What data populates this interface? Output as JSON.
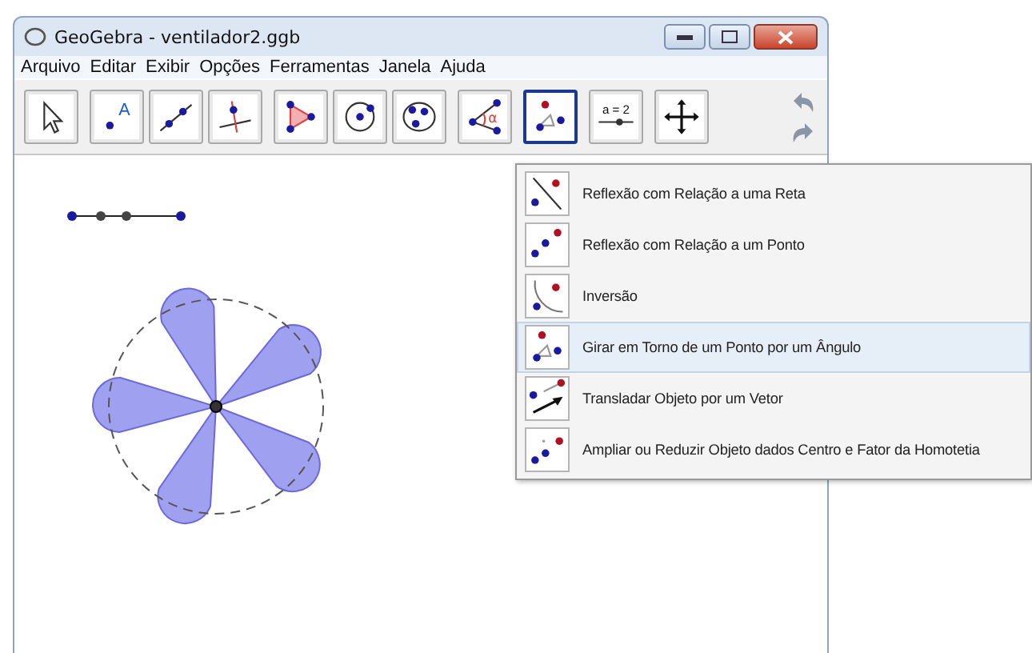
{
  "window": {
    "title": "GeoGebra - ventilador2.ggb"
  },
  "menu": [
    "Arquivo",
    "Editar",
    "Exibir",
    "Opções",
    "Ferramentas",
    "Janela",
    "Ajuda"
  ],
  "toolbar": [
    {
      "kind": "move",
      "selected": false
    },
    {
      "kind": "point",
      "label": "A",
      "selected": false
    },
    {
      "kind": "line",
      "selected": false
    },
    {
      "kind": "perpendicular",
      "selected": false
    },
    {
      "kind": "polygon",
      "selected": false
    },
    {
      "kind": "circle",
      "selected": false
    },
    {
      "kind": "conic",
      "selected": false
    },
    {
      "kind": "angle",
      "label": "α",
      "selected": false
    },
    {
      "kind": "rotate",
      "selected": true
    },
    {
      "kind": "slider",
      "label": "a = 2",
      "selected": false
    },
    {
      "kind": "pan",
      "selected": false
    }
  ],
  "tool_menu": [
    {
      "kind": "reflect-line",
      "label": "Reflexão com Relação a uma Reta",
      "selected": false
    },
    {
      "kind": "reflect-point",
      "label": "Reflexão com Relação a um Ponto",
      "selected": false
    },
    {
      "kind": "inversion",
      "label": "Inversão",
      "selected": false
    },
    {
      "kind": "rotate",
      "label": "Girar em Torno de um Ponto por um Ângulo",
      "selected": true
    },
    {
      "kind": "translate",
      "label": "Transladar Objeto por um Vetor",
      "selected": false
    },
    {
      "kind": "dilate",
      "label": "Ampliar ou Reduzir Objeto dados Centro e Fator da Homotetia",
      "selected": false
    }
  ]
}
